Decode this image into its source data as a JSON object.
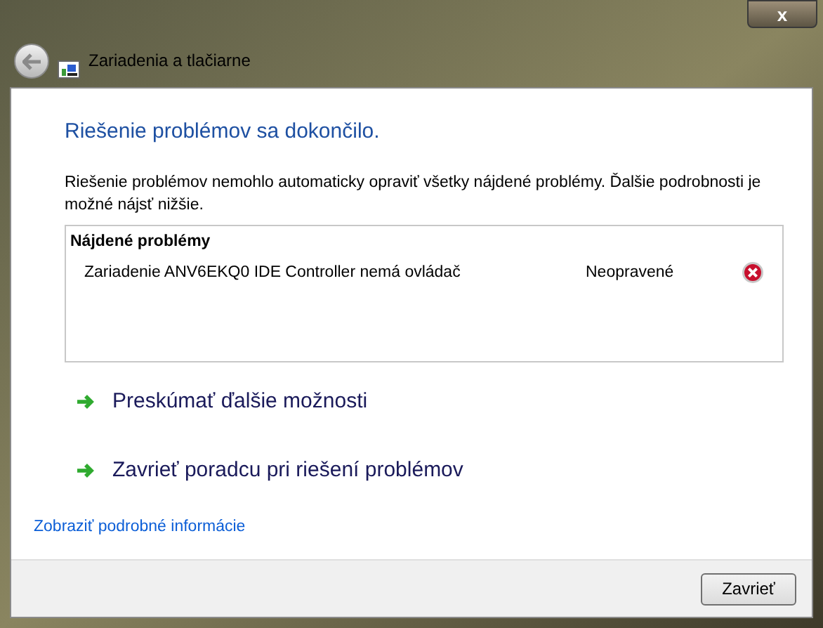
{
  "window": {
    "title": "Zariadenia a tlačiarne",
    "close": "x"
  },
  "heading": "Riešenie problémov sa dokončilo.",
  "description": "Riešenie problémov nemohlo automaticky opraviť všetky nájdené problémy. Ďalšie podrobnosti je možné nájsť nižšie.",
  "problems": {
    "title": "Nájdené problémy",
    "items": [
      {
        "text": "Zariadenie ANV6EKQ0 IDE Controller nemá ovládač",
        "status": "Neopravené",
        "fixed": false
      }
    ]
  },
  "actions": [
    "Preskúmať ďalšie možnosti",
    "Zavrieť poradcu pri riešení problémov"
  ],
  "details_link": "Zobraziť podrobné informácie",
  "buttons": [
    "Zavrieť"
  ]
}
